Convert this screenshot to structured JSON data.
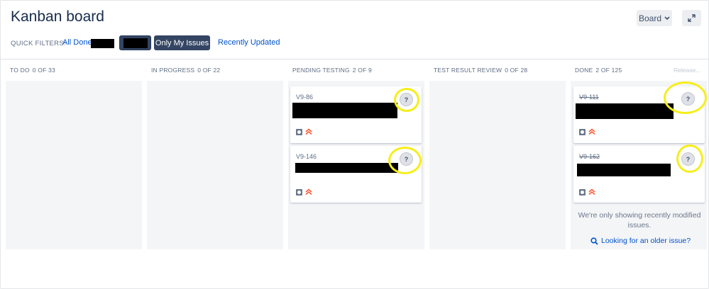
{
  "header": {
    "title": "Kanban board",
    "board_button": "Board",
    "board_chevron": "chevron-down-icon",
    "expand_icon": "expand-arrows-icon"
  },
  "quick_filters": {
    "label": "QUICK FILTERS:",
    "items": [
      "All Done",
      "Only My Issues",
      "Recently Updated"
    ]
  },
  "release_link": "Release...",
  "columns": [
    {
      "name": "TO DO",
      "count": "0 OF 33"
    },
    {
      "name": "IN PROGRESS",
      "count": "0 OF 22"
    },
    {
      "name": "PENDING TESTING",
      "count": "2 OF 9"
    },
    {
      "name": "TEST RESULT REVIEW",
      "count": "0 OF 28"
    },
    {
      "name": "DONE",
      "count": "2 OF 125"
    }
  ],
  "cards": {
    "pending_testing": [
      {
        "key": "V9-86",
        "avatar": "?"
      },
      {
        "key": "V9-146",
        "avatar": "?"
      }
    ],
    "done": [
      {
        "key": "V9-111",
        "avatar": "?"
      },
      {
        "key": "V9-162",
        "avatar": "?"
      }
    ]
  },
  "done_note": "We're only showing recently modified issues.",
  "older_link": "Looking for an older issue?",
  "colors": {
    "highlight_ring": "#f6ee1b",
    "link": "#0052cc",
    "column_bg": "#f4f5f7",
    "dark_button": "#344563"
  }
}
